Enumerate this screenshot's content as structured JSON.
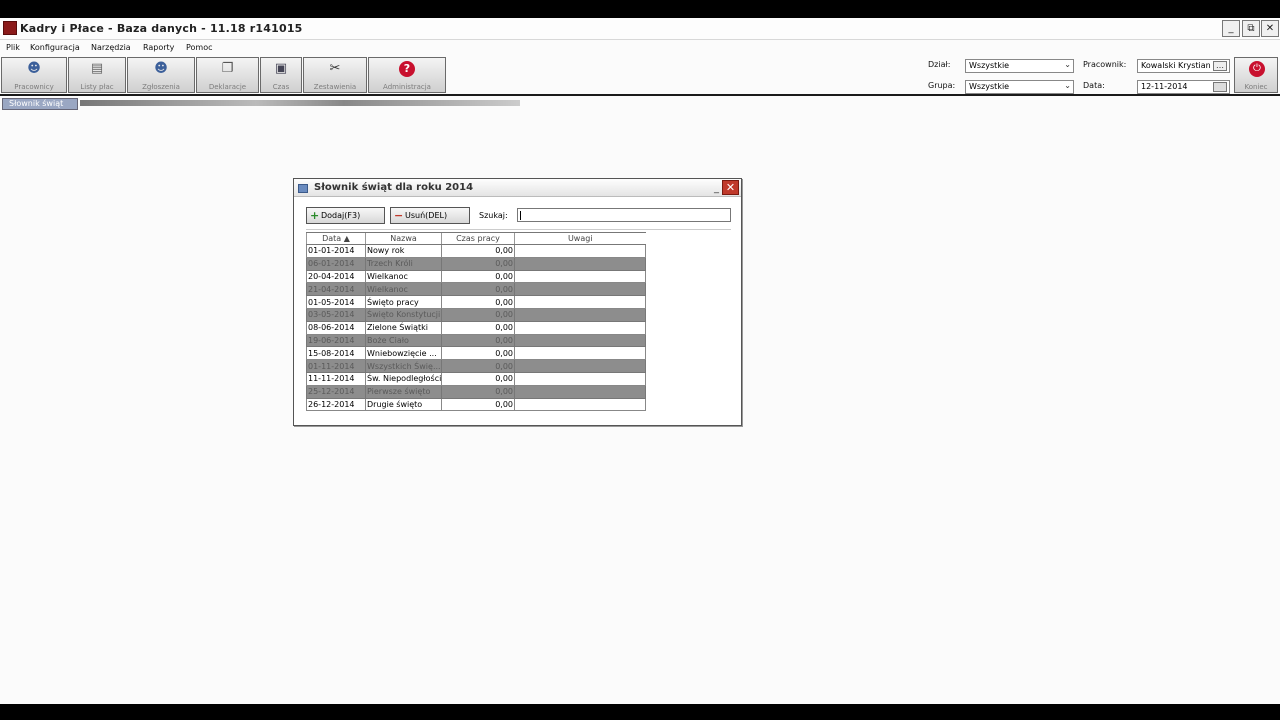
{
  "window": {
    "title": "Kadry i Płace - Baza danych - 11.18  r141015",
    "controls": [
      "_",
      "⧉",
      "✕"
    ]
  },
  "menu": [
    "Plik",
    "Konfiguracja",
    "Narzędzia",
    "Raporty",
    "Pomoc"
  ],
  "toolbar": {
    "buttons": [
      {
        "label": "Pracownicy",
        "icon": "people-icon"
      },
      {
        "label": "Listy płac",
        "icon": "document-icon"
      },
      {
        "label": "Zgłoszenia",
        "icon": "people-group-icon"
      },
      {
        "label": "Deklaracje",
        "icon": "forms-icon"
      },
      {
        "label": "Czas",
        "icon": "calendar-icon"
      },
      {
        "label": "Zestawienia",
        "icon": "tools-icon"
      },
      {
        "label": "Administracja",
        "icon": "help-icon"
      }
    ],
    "filters": {
      "dzial_label": "Dział:",
      "dzial_value": "Wszystkie",
      "grupa_label": "Grupa:",
      "grupa_value": "Wszystkie",
      "pracownik_label": "Pracownik:",
      "pracownik_value": "Kowalski Krystian",
      "data_label": "Data:",
      "data_value": "12-11-2014"
    },
    "close_label": "Koniec"
  },
  "tabs": {
    "active": "Słownik świąt"
  },
  "dialog": {
    "title": "Słownik świąt dla roku 2014",
    "add_button": "Dodaj(F3)",
    "delete_button": "Usuń(DEL)",
    "search_label": "Szukaj:",
    "search_value": "",
    "columns": [
      "Data",
      "Nazwa",
      "Czas pracy",
      "Uwagi"
    ],
    "sort_indicator": "▲",
    "rows": [
      {
        "data": "01-01-2014",
        "nazwa": "Nowy rok",
        "czas": "0,00",
        "uwagi": "",
        "selected": false
      },
      {
        "data": "06-01-2014",
        "nazwa": "Trzech Króli",
        "czas": "0,00",
        "uwagi": "",
        "selected": true
      },
      {
        "data": "20-04-2014",
        "nazwa": "Wielkanoc",
        "czas": "0,00",
        "uwagi": "",
        "selected": false
      },
      {
        "data": "21-04-2014",
        "nazwa": "Wielkanoc",
        "czas": "0,00",
        "uwagi": "",
        "selected": true
      },
      {
        "data": "01-05-2014",
        "nazwa": "Święto pracy",
        "czas": "0,00",
        "uwagi": "",
        "selected": false
      },
      {
        "data": "03-05-2014",
        "nazwa": "Święto Konstytucji",
        "czas": "0,00",
        "uwagi": "",
        "selected": true
      },
      {
        "data": "08-06-2014",
        "nazwa": "Zielone Świątki",
        "czas": "0,00",
        "uwagi": "",
        "selected": false
      },
      {
        "data": "19-06-2014",
        "nazwa": "Boże Ciało",
        "czas": "0,00",
        "uwagi": "",
        "selected": true
      },
      {
        "data": "15-08-2014",
        "nazwa": "Wniebowzięcie ...",
        "czas": "0,00",
        "uwagi": "",
        "selected": false
      },
      {
        "data": "01-11-2014",
        "nazwa": "Wszystkich Świę...",
        "czas": "0,00",
        "uwagi": "",
        "selected": true
      },
      {
        "data": "11-11-2014",
        "nazwa": "Św. Niepodległości",
        "czas": "0,00",
        "uwagi": "",
        "selected": false
      },
      {
        "data": "25-12-2014",
        "nazwa": "Pierwsze święto",
        "czas": "0,00",
        "uwagi": "",
        "selected": true
      },
      {
        "data": "26-12-2014",
        "nazwa": "Drugie święto",
        "czas": "0,00",
        "uwagi": "",
        "selected": false
      }
    ]
  }
}
